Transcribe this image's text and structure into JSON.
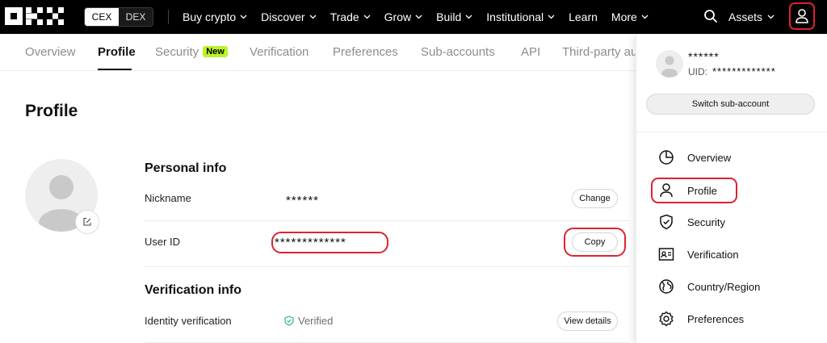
{
  "topnav": {
    "logo_text": "OKX",
    "cex_label": "CEX",
    "dex_label": "DEX",
    "menu": [
      {
        "label": "Buy crypto",
        "has_caret": true
      },
      {
        "label": "Discover",
        "has_caret": true
      },
      {
        "label": "Trade",
        "has_caret": true
      },
      {
        "label": "Grow",
        "has_caret": true
      },
      {
        "label": "Build",
        "has_caret": true
      },
      {
        "label": "Institutional",
        "has_caret": true
      },
      {
        "label": "Learn",
        "has_caret": false
      },
      {
        "label": "More",
        "has_caret": true
      }
    ],
    "assets_label": "Assets"
  },
  "tabs": {
    "items": [
      "Overview",
      "Profile",
      "Security",
      "Verification",
      "Preferences",
      "Sub-accounts",
      "API",
      "Third-party au"
    ],
    "active": "Profile",
    "new_badge": "New"
  },
  "profile": {
    "title": "Profile",
    "personal_info_title": "Personal info",
    "nickname_label": "Nickname",
    "nickname_value": "******",
    "change_label": "Change",
    "user_id_label": "User ID",
    "user_id_value": "*************",
    "copy_label": "Copy",
    "verification_info_title": "Verification info",
    "identity_label": "Identity verification",
    "verified_label": "Verified",
    "view_details_label": "View details"
  },
  "dropdown": {
    "name": "******",
    "uid_label": "UID:",
    "uid_value": "*************",
    "switch_label": "Switch sub-account",
    "items": [
      {
        "label": "Overview",
        "icon": "pie-chart-icon"
      },
      {
        "label": "Profile",
        "icon": "person-icon"
      },
      {
        "label": "Security",
        "icon": "shield-icon"
      },
      {
        "label": "Verification",
        "icon": "id-card-icon"
      },
      {
        "label": "Country/Region",
        "icon": "globe-icon"
      },
      {
        "label": "Preferences",
        "icon": "gear-icon"
      }
    ]
  },
  "colors": {
    "highlight": "#e0222f",
    "new_badge": "#baf329",
    "verified_green": "#2bb673"
  }
}
